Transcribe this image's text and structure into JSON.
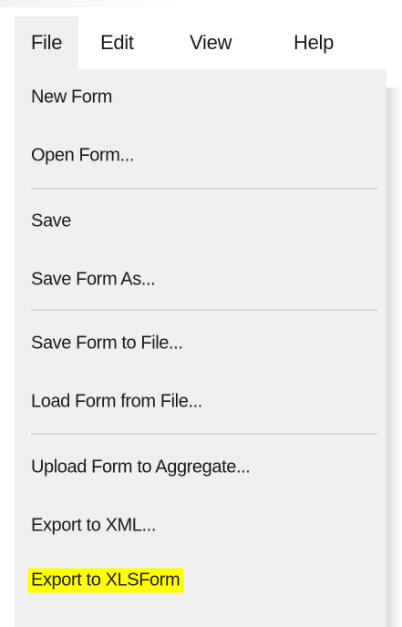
{
  "menubar": {
    "items": [
      {
        "label": "File",
        "active": true
      },
      {
        "label": "Edit",
        "active": false
      },
      {
        "label": "View",
        "active": false
      },
      {
        "label": "Help",
        "active": false
      }
    ]
  },
  "file_menu": {
    "groups": [
      [
        {
          "label": "New Form"
        },
        {
          "label": "Open Form..."
        }
      ],
      [
        {
          "label": "Save"
        },
        {
          "label": "Save Form As..."
        }
      ],
      [
        {
          "label": "Save Form to File..."
        },
        {
          "label": "Load Form from File..."
        }
      ],
      [
        {
          "label": "Upload Form to Aggregate..."
        },
        {
          "label": "Export to XML..."
        },
        {
          "label": "Export to XLSForm",
          "highlighted": true
        }
      ]
    ]
  },
  "colors": {
    "menu_background": "#efefef",
    "highlight": "#ffff00",
    "text": "#1a1a1a",
    "separator": "#d6d6d6"
  }
}
